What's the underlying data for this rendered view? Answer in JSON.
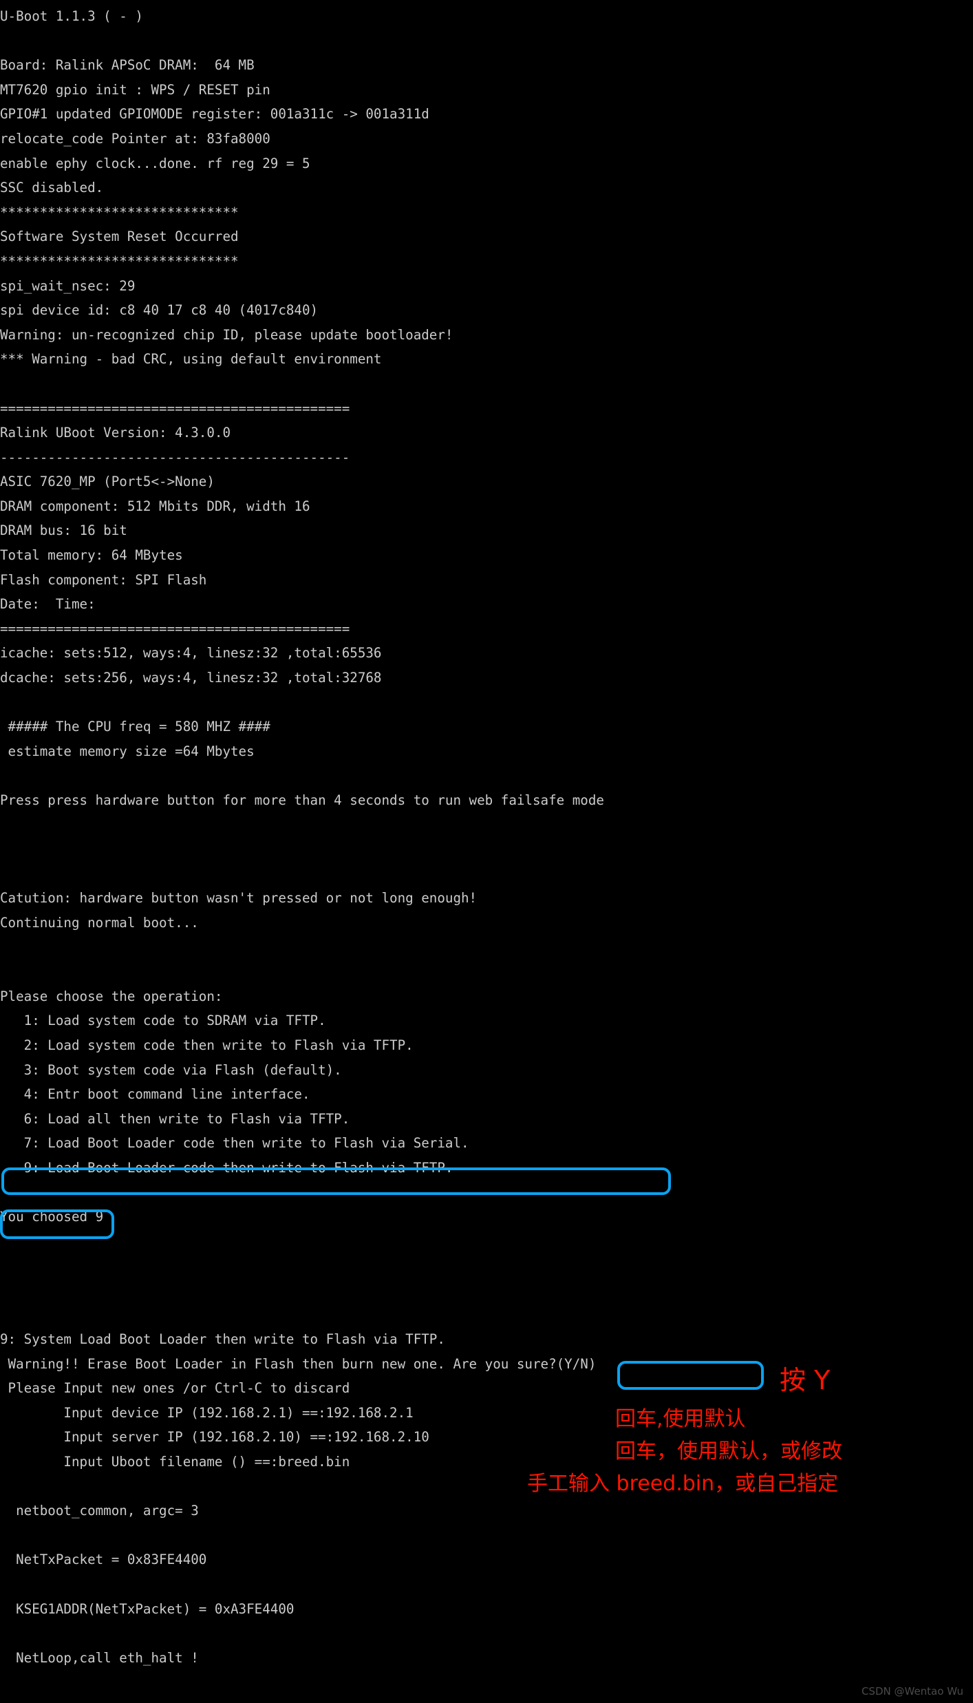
{
  "terminal": {
    "lines": [
      "U-Boot 1.1.3 ( - )",
      "",
      "Board: Ralink APSoC DRAM:  64 MB",
      "MT7620 gpio init : WPS / RESET pin",
      "GPIO#1 updated GPIOMODE register: 001a311c -> 001a311d",
      "relocate_code Pointer at: 83fa8000",
      "enable ephy clock...done. rf reg 29 = 5",
      "SSC disabled.",
      "******************************",
      "Software System Reset Occurred",
      "******************************",
      "spi_wait_nsec: 29",
      "spi device id: c8 40 17 c8 40 (4017c840)",
      "Warning: un-recognized chip ID, please update bootloader!",
      "*** Warning - bad CRC, using default environment",
      "",
      "============================================",
      "Ralink UBoot Version: 4.3.0.0",
      "--------------------------------------------",
      "ASIC 7620_MP (Port5<->None)",
      "DRAM component: 512 Mbits DDR, width 16",
      "DRAM bus: 16 bit",
      "Total memory: 64 MBytes",
      "Flash component: SPI Flash",
      "Date:  Time:",
      "============================================",
      "icache: sets:512, ways:4, linesz:32 ,total:65536",
      "dcache: sets:256, ways:4, linesz:32 ,total:32768",
      "",
      " ##### The CPU freq = 580 MHZ ####",
      " estimate memory size =64 Mbytes",
      "",
      "Press press hardware button for more than 4 seconds to run web failsafe mode",
      "",
      "",
      "",
      "Catution: hardware button wasn't pressed or not long enough!",
      "Continuing normal boot...",
      "",
      "",
      "Please choose the operation:",
      "   1: Load system code to SDRAM via TFTP.",
      "   2: Load system code then write to Flash via TFTP.",
      "   3: Boot system code via Flash (default).",
      "   4: Entr boot command line interface.",
      "   6: Load all then write to Flash via TFTP.",
      "   7: Load Boot Loader code then write to Flash via Serial.",
      "   9: Load Boot Loader code then write to Flash via TFTP.",
      "",
      "You choosed 9",
      "",
      "",
      "",
      "",
      "9: System Load Boot Loader then write to Flash via TFTP.",
      " Warning!! Erase Boot Loader in Flash then burn new one. Are you sure?(Y/N)",
      " Please Input new ones /or Ctrl-C to discard",
      "        Input device IP (192.168.2.1) ==:192.168.2.1",
      "        Input server IP (192.168.2.10) ==:192.168.2.10",
      "        Input Uboot filename () ==:breed.bin",
      "",
      "  netboot_common, argc= 3",
      "",
      "  NetTxPacket = 0x83FE4400",
      "",
      "  KSEG1ADDR(NetTxPacket) = 0xA3FE4400",
      "",
      "  NetLoop,call eth_halt !"
    ]
  },
  "annotations": {
    "accent_color": "#0aa2f0",
    "note_color": "#ff1400",
    "boxes": [
      {
        "name": "option-9-highlight",
        "label": "9: Load Boot Loader code then write to Flash via TFTP."
      },
      {
        "name": "you-choosed-9-highlight",
        "label": "You choosed 9"
      },
      {
        "name": "are-you-sure-highlight",
        "label": "Are you sure?(Y/N)"
      }
    ],
    "notes": [
      {
        "name": "press-y-note",
        "text": "按 Y"
      },
      {
        "name": "enter-default-note",
        "text": "回车,使用默认"
      },
      {
        "name": "enter-default-or-modify-note",
        "text": "回车，使用默认，或修改"
      },
      {
        "name": "manual-input-note",
        "text": "手工输入 breed.bin，或自己指定"
      }
    ]
  },
  "watermark": {
    "text": "CSDN @Wentao Wu"
  }
}
